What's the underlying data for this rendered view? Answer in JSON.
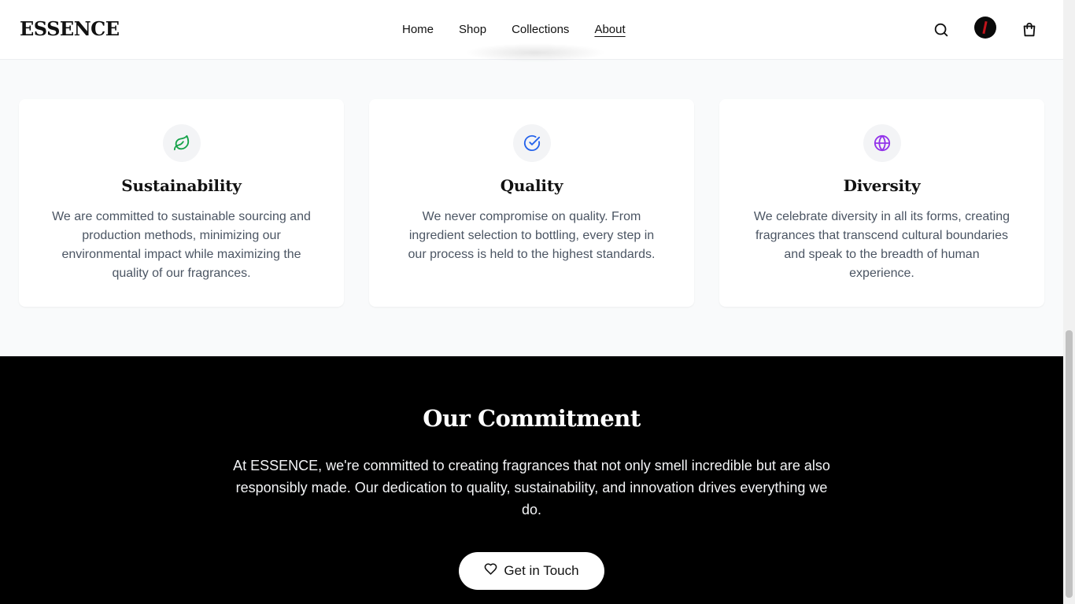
{
  "header": {
    "logo": "ESSENCE",
    "nav": [
      {
        "label": "Home",
        "active": false
      },
      {
        "label": "Shop",
        "active": false
      },
      {
        "label": "Collections",
        "active": false
      },
      {
        "label": "About",
        "active": true
      }
    ],
    "icons": [
      "search-icon",
      "user-avatar",
      "shopping-bag-icon"
    ]
  },
  "values": {
    "cards": [
      {
        "icon": "leaf-icon",
        "icon_color": "#16a34a",
        "title": "Sustainability",
        "text": "We are committed to sustainable sourcing and production methods, minimizing our environmental impact while maximizing the quality of our fragrances."
      },
      {
        "icon": "check-circle-icon",
        "icon_color": "#2563eb",
        "title": "Quality",
        "text": "We never compromise on quality. From ingredient selection to bottling, every step in our process is held to the highest standards."
      },
      {
        "icon": "globe-icon",
        "icon_color": "#9333ea",
        "title": "Diversity",
        "text": "We celebrate diversity in all its forms, creating fragrances that transcend cultural boundaries and speak to the breadth of human experience."
      }
    ]
  },
  "commitment": {
    "title": "Our Commitment",
    "text": "At ESSENCE, we're committed to creating fragrances that not only smell incredible but are also responsibly made. Our dedication to quality, sustainability, and innovation drives everything we do.",
    "cta_label": "Get in Touch",
    "cta_icon": "heart-icon"
  },
  "colors": {
    "background": "#f9fafb",
    "commitment_bg": "#000000",
    "card_bg": "#ffffff"
  }
}
